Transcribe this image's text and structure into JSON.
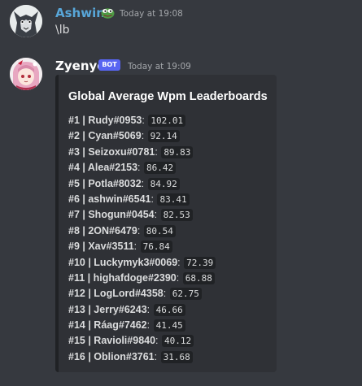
{
  "messages": [
    {
      "username": "Ashwin",
      "username_color": "#58a6d8",
      "emoji": "pepe-emoji",
      "timestamp": "Today at 19:08",
      "content": "\\lb"
    },
    {
      "username": "Zyenyo",
      "username_color": "#ffffff",
      "bot_tag": "BOT",
      "bot_tag_color": "#5865f2",
      "timestamp": "Today at 19:09",
      "embed": {
        "title": "Global Average Wpm Leaderboards",
        "rows": [
          {
            "label": "#1 | Rudy#0953",
            "sep": ":",
            "value": "102.01"
          },
          {
            "label": "#2 | Cyan#5069",
            "sep": ":",
            "value": "92.14"
          },
          {
            "label": "#3 | Seizoxu#0781",
            "sep": ":",
            "value": "89.83"
          },
          {
            "label": "#4 | Alea#2153",
            "sep": ":",
            "value": "86.42"
          },
          {
            "label": "#5 | Potla#8032",
            "sep": ":",
            "value": "84.92"
          },
          {
            "label": "#6 | ashwin#6541",
            "sep": ":",
            "value": "83.41"
          },
          {
            "label": "#7 | Shogun#0454",
            "sep": ":",
            "value": "82.53"
          },
          {
            "label": "#8 | 2ON#6479",
            "sep": ":",
            "value": "80.54"
          },
          {
            "label": "#9 | Xav#3511",
            "sep": ":",
            "value": "76.84"
          },
          {
            "label": "#10 | Luckymyk3#0069",
            "sep": ":",
            "value": "72.39"
          },
          {
            "label": "#11 | highafdoge#2390",
            "sep": ":",
            "value": "68.88"
          },
          {
            "label": "#12 | LogLord#4358",
            "sep": ":",
            "value": "62.75"
          },
          {
            "label": "#13 | Jerry#6243",
            "sep": ":",
            "value": "46.66"
          },
          {
            "label": "#14 | Ráag#7462",
            "sep": ":",
            "value": "41.45"
          },
          {
            "label": "#15 | Ravioli#9840",
            "sep": ":",
            "value": "40.12"
          },
          {
            "label": "#16 | Oblion#3761",
            "sep": ":",
            "value": "31.68"
          }
        ]
      }
    }
  ]
}
